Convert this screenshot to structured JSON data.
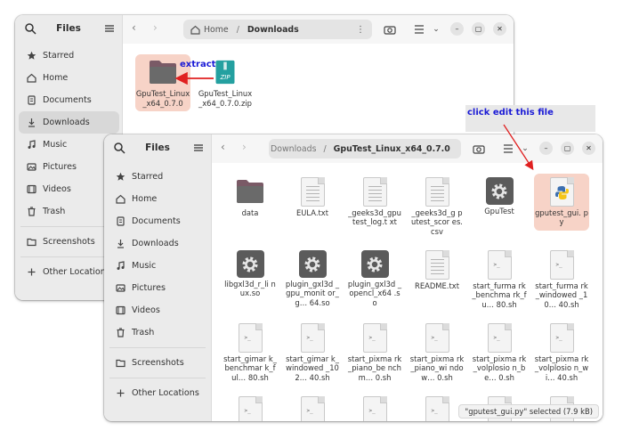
{
  "back_window": {
    "sidebar": {
      "title": "Files",
      "items": [
        {
          "label": "Starred",
          "icon": "star-icon"
        },
        {
          "label": "Home",
          "icon": "home-icon"
        },
        {
          "label": "Documents",
          "icon": "documents-icon"
        },
        {
          "label": "Downloads",
          "icon": "downloads-icon",
          "active": true
        },
        {
          "label": "Music",
          "icon": "music-icon"
        },
        {
          "label": "Pictures",
          "icon": "pictures-icon"
        },
        {
          "label": "Videos",
          "icon": "videos-icon"
        },
        {
          "label": "Trash",
          "icon": "trash-icon"
        },
        {
          "label": "Screenshots",
          "icon": "folder-icon"
        },
        {
          "label": "Other Locations",
          "icon": "plus-icon"
        }
      ]
    },
    "path": {
      "home": "Home",
      "sep": "/",
      "current": "Downloads"
    },
    "files": [
      {
        "label": "GpuTest_Linux_x64_0.7.0",
        "type": "folder",
        "selected": true
      },
      {
        "label": "GpuTest_Linux_x64_0.7.0.zip",
        "type": "zip"
      }
    ]
  },
  "front_window": {
    "sidebar": {
      "title": "Files",
      "items": [
        {
          "label": "Starred",
          "icon": "star-icon"
        },
        {
          "label": "Home",
          "icon": "home-icon"
        },
        {
          "label": "Documents",
          "icon": "documents-icon"
        },
        {
          "label": "Downloads",
          "icon": "downloads-icon"
        },
        {
          "label": "Music",
          "icon": "music-icon"
        },
        {
          "label": "Pictures",
          "icon": "pictures-icon"
        },
        {
          "label": "Videos",
          "icon": "videos-icon"
        },
        {
          "label": "Trash",
          "icon": "trash-icon"
        },
        {
          "label": "Screenshots",
          "icon": "folder-icon"
        },
        {
          "label": "Other Locations",
          "icon": "plus-icon"
        }
      ]
    },
    "path": {
      "parent": "Downloads",
      "sep": "/",
      "current": "GpuTest_Linux_x64_0.7.0"
    },
    "files": [
      {
        "label": "data",
        "type": "folder"
      },
      {
        "label": "EULA.txt",
        "type": "text"
      },
      {
        "label": "_geeks3d_gpu test_log.t xt",
        "type": "text"
      },
      {
        "label": "_geeks3d_g putest_scor es.csv",
        "type": "text"
      },
      {
        "label": "GpuTest",
        "type": "exec"
      },
      {
        "label": "gputest_gui. py",
        "type": "python",
        "selected": true
      },
      {
        "label": "libgxl3d_r_li nux.so",
        "type": "exec"
      },
      {
        "label": "plugin_gxl3d _gpu_monit or_g… 64.so",
        "type": "exec"
      },
      {
        "label": "plugin_gxl3d _opencl_x64 .so",
        "type": "exec"
      },
      {
        "label": "README.txt",
        "type": "text"
      },
      {
        "label": "start_furma rk_benchma rk_fu… 80.sh",
        "type": "script"
      },
      {
        "label": "start_furma rk_windowed _10… 40.sh",
        "type": "script"
      },
      {
        "label": "start_gimar k_benchmar k_ful… 80.sh",
        "type": "script"
      },
      {
        "label": "start_gimar k_windowed _102… 40.sh",
        "type": "script"
      },
      {
        "label": "start_pixma rk_piano_be nchm… 0.sh",
        "type": "script"
      },
      {
        "label": "start_pixma rk_piano_wi ndow… 0.sh",
        "type": "script"
      },
      {
        "label": "start_pixma rk_volplosio n_be… 0.sh",
        "type": "script"
      },
      {
        "label": "start_pixma rk_volplosio n_wi… 40.sh",
        "type": "script"
      },
      {
        "label": "",
        "type": "script"
      },
      {
        "label": "",
        "type": "script"
      },
      {
        "label": "",
        "type": "script"
      },
      {
        "label": "",
        "type": "script"
      },
      {
        "label": "",
        "type": "script"
      },
      {
        "label": "",
        "type": "script"
      }
    ],
    "status": "\"gputest_gui.py\" selected  (7.9 kB)"
  },
  "annotations": {
    "extract": "extract",
    "click_edit": "click edit this file",
    "color": "#1b1bd6",
    "arrow_color": "#e02020"
  },
  "colors": {
    "selection": "#f7d3c7",
    "folder": "#7a5a66",
    "python_blue": "#3b6fb0",
    "python_yellow": "#f5c518",
    "zip_teal": "#24a0a0"
  }
}
